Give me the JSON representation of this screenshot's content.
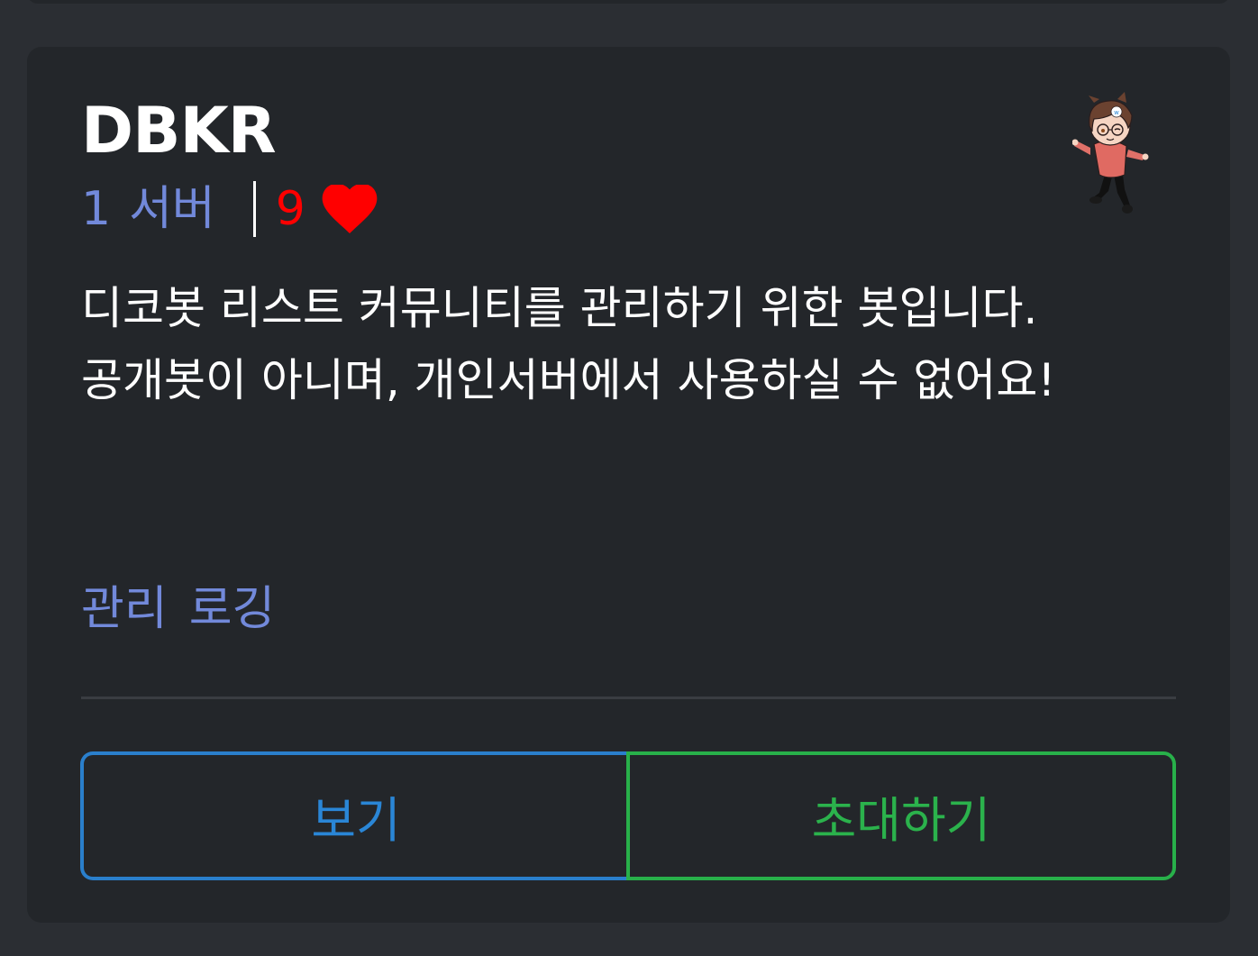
{
  "bot": {
    "name": "DBKR",
    "servers": "1",
    "servers_unit": "서버",
    "hearts": "9",
    "description_lines": [
      "디코봇 리스트 커뮤니티를 관리하기 위한 봇입니다.",
      "공개봇이 아니며, 개인서버에서 사용하실 수 없어요!"
    ],
    "tags": [
      "관리",
      "로깅"
    ]
  },
  "actions": {
    "view_label": "보기",
    "invite_label": "초대하기"
  },
  "icons": {
    "heart": "heart-icon",
    "avatar": "chibi-character-avatar"
  },
  "colors": {
    "background": "#2b2e33",
    "card": "#23262a",
    "blurple": "#7289da",
    "heart_red": "#ff0000",
    "view_blue": "#2a86d6",
    "invite_green": "#2bb24c"
  }
}
